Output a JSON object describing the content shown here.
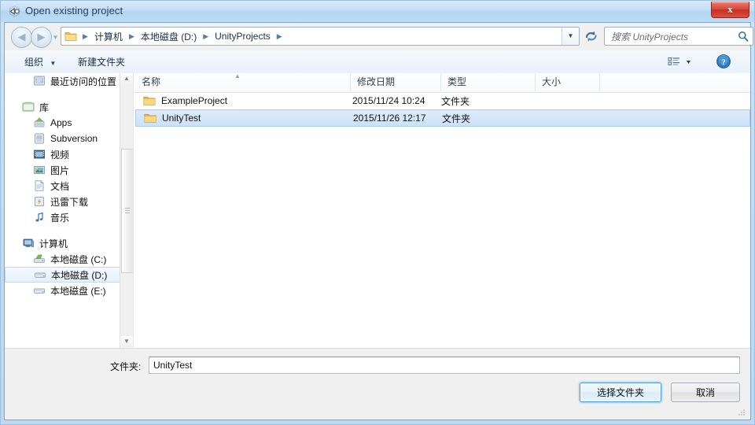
{
  "window": {
    "title": "Open existing project",
    "app_icon": "unity-logo-icon",
    "close_label": "x"
  },
  "navbar": {
    "back_label": "◀",
    "forward_label": "▶",
    "history_dropdown_label": "▼",
    "address_dropdown_label": "▼",
    "refresh_icon": "refresh-icon",
    "breadcrumbs": [
      {
        "label": "计算机"
      },
      {
        "label": "本地磁盘 (D:)"
      },
      {
        "label": "UnityProjects"
      }
    ],
    "separator": "▶",
    "search": {
      "placeholder": "搜索 UnityProjects",
      "icon": "search-icon"
    }
  },
  "toolbar": {
    "organize_label": "组织",
    "organize_caret": "▼",
    "new_folder_label": "新建文件夹",
    "view_icon": "view-options-icon",
    "view_caret": "▼",
    "help_icon": "help-icon",
    "help_label": "?"
  },
  "sidebar": {
    "items": [
      {
        "label": "最近访问的位置",
        "icon": "recent-places-icon",
        "level": 0,
        "selected": false
      },
      {
        "label": "库",
        "icon": "library-icon",
        "level": 0,
        "selected": false,
        "gap_before": true
      },
      {
        "label": "Apps",
        "icon": "apps-icon",
        "level": 1,
        "selected": false
      },
      {
        "label": "Subversion",
        "icon": "subversion-icon",
        "level": 1,
        "selected": false
      },
      {
        "label": "视频",
        "icon": "video-icon",
        "level": 1,
        "selected": false
      },
      {
        "label": "图片",
        "icon": "pictures-icon",
        "level": 1,
        "selected": false
      },
      {
        "label": "文档",
        "icon": "documents-icon",
        "level": 1,
        "selected": false
      },
      {
        "label": "迅雷下载",
        "icon": "thunder-download-icon",
        "level": 1,
        "selected": false
      },
      {
        "label": "音乐",
        "icon": "music-icon",
        "level": 1,
        "selected": false
      },
      {
        "label": "计算机",
        "icon": "computer-icon",
        "level": 0,
        "selected": false,
        "gap_before": true
      },
      {
        "label": "本地磁盘 (C:)",
        "icon": "system-drive-icon",
        "level": 1,
        "selected": false
      },
      {
        "label": "本地磁盘 (D:)",
        "icon": "drive-icon",
        "level": 1,
        "selected": true
      },
      {
        "label": "本地磁盘 (E:)",
        "icon": "drive-icon",
        "level": 1,
        "selected": false
      }
    ],
    "scrollbar": {
      "up_arrow": "▲",
      "down_arrow": "▼"
    }
  },
  "file_list": {
    "columns": [
      {
        "label": "名称",
        "key": "name"
      },
      {
        "label": "修改日期",
        "key": "date"
      },
      {
        "label": "类型",
        "key": "type"
      },
      {
        "label": "大小",
        "key": "size"
      }
    ],
    "sort_indicator": "▲",
    "rows": [
      {
        "name": "ExampleProject",
        "date": "2015/11/24 10:24",
        "type": "文件夹",
        "size": "",
        "icon": "folder-icon",
        "selected": false
      },
      {
        "name": "UnityTest",
        "date": "2015/11/26 12:17",
        "type": "文件夹",
        "size": "",
        "icon": "folder-icon",
        "selected": true
      }
    ]
  },
  "footer": {
    "folder_label": "文件夹:",
    "folder_value": "UnityTest",
    "select_button": "选择文件夹",
    "cancel_button": "取消"
  },
  "colors": {
    "title_bar": "#b3d4f2",
    "window_border": "#7ea7c9",
    "selection": "#cde2f7",
    "default_button_glow": "#4a9fd4",
    "close_button": "#c33124",
    "folder_icon": "#f6c659"
  }
}
